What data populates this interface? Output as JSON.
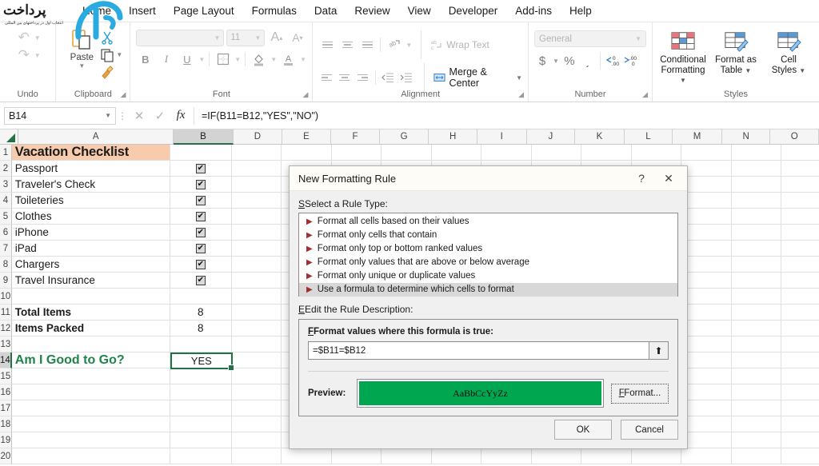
{
  "ribbon": {
    "tabs": [
      "Home",
      "Insert",
      "Page Layout",
      "Formulas",
      "Data",
      "Review",
      "View",
      "Developer",
      "Add-ins",
      "Help"
    ],
    "groups": {
      "undo": {
        "label": "Undo",
        "undo_icon": "undo-arrow-icon",
        "redo_icon": "redo-arrow-icon"
      },
      "clipboard": {
        "label": "Clipboard",
        "paste_label": "Paste",
        "cut_icon": "scissors-icon",
        "copy_icon": "copy-icon",
        "format_painter_icon": "paintbrush-icon"
      },
      "font": {
        "label": "Font",
        "font_name": "",
        "font_size": "11",
        "bold": "B",
        "italic": "I",
        "underline": "U",
        "grow_font": "A",
        "shrink_font": "A",
        "borders_icon": "borders-icon",
        "fill_color_icon": "fill-color-icon",
        "font_color_icon": "font-color-icon"
      },
      "alignment": {
        "label": "Alignment",
        "wrap_text": "Wrap Text",
        "merge_center": "Merge & Center",
        "orientation_icon": "orientation-icon",
        "indent_decrease_icon": "decrease-indent-icon",
        "indent_increase_icon": "increase-indent-icon"
      },
      "number": {
        "label": "Number",
        "format": "General",
        "currency": "$",
        "percent": "%",
        "comma": "͵",
        "decrease_decimal": "decrease-decimal-icon",
        "increase_decimal": "increase-decimal-icon"
      },
      "styles": {
        "label": "Styles",
        "conditional_formatting": "Conditional\nFormatting",
        "conditional_formatting_l1": "Conditional",
        "conditional_formatting_l2": "Formatting",
        "format_as_table_l1": "Format as",
        "format_as_table_l2": "Table",
        "cell_styles_l1": "Cell",
        "cell_styles_l2": "Styles"
      }
    }
  },
  "formula_bar": {
    "name_box": "B14",
    "cancel_icon": "cancel-x-icon",
    "enter_icon": "enter-check-icon",
    "fx_icon": "fx",
    "formula": "=IF(B11=B12,\"YES\",\"NO\")"
  },
  "sheet": {
    "columns": [
      "A",
      "B",
      "D",
      "E",
      "F",
      "G",
      "H",
      "I",
      "J",
      "K",
      "L",
      "M",
      "N",
      "O"
    ],
    "selected_column": "B",
    "selected_row": 14,
    "rows": [
      1,
      2,
      3,
      4,
      5,
      6,
      7,
      8,
      9,
      10,
      11,
      12,
      13,
      14,
      15,
      16,
      17,
      18,
      19,
      20
    ],
    "cells": {
      "A1": "Vacation Checklist",
      "A2": "Passport",
      "A3": "Traveler's Check",
      "A4": "Toileteries",
      "A5": "Clothes",
      "A6": "iPhone",
      "A7": "iPad",
      "A8": "Chargers",
      "A9": "Travel Insurance",
      "A11": "Total Items",
      "A12": "Items Packed",
      "A14": "Am I Good to Go?",
      "B11": "8",
      "B12": "8",
      "B14": "YES"
    },
    "checkbox_rows": [
      2,
      3,
      4,
      5,
      6,
      7,
      8,
      9
    ],
    "checkbox_glyph": "✔",
    "title_fill_color": "#f8cbad",
    "accent_green": "#217346",
    "label_green": "#1e8449"
  },
  "dialog": {
    "title": "New Formatting Rule",
    "help_button": "?",
    "close_button": "✕",
    "rule_type_label": "Select a Rule Type:",
    "rule_types": [
      "Format all cells based on their values",
      "Format only cells that contain",
      "Format only top or bottom ranked values",
      "Format only values that are above or below average",
      "Format only unique or duplicate values",
      "Use a formula to determine which cells to format"
    ],
    "selected_rule_index": 5,
    "description_label": "Edit the Rule Description:",
    "formula_label": "Format values where this formula is true:",
    "formula_value": "=$B11=$B12",
    "collapse_icon": "collapse-dialog-icon",
    "preview_label": "Preview:",
    "preview_text": "AaBbCcYyZz",
    "preview_color": "#00a650",
    "format_button": "Format...",
    "ok_button": "OK",
    "cancel_button": "Cancel"
  }
}
